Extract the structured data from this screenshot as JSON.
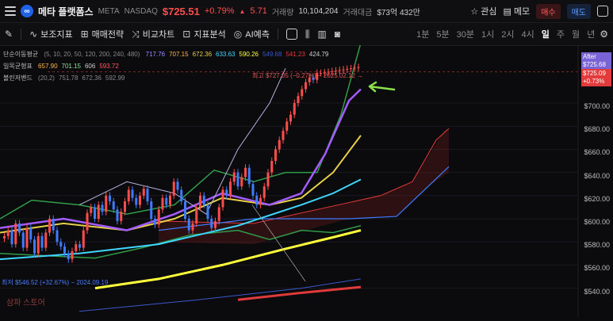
{
  "header": {
    "logo_letter": "∞",
    "name": "메타 플랫폼스",
    "ticker": "META",
    "exchange": "NASDAQ",
    "price": "$725.51",
    "change_pct": "+0.79%",
    "change_arrow": "▲",
    "change_abs": "5.71",
    "volume_label": "거래량",
    "volume_value": "10,104,204",
    "amount_label": "거래대금",
    "amount_value": "$73억 432만",
    "watch_label": "관심",
    "memo_label": "메모",
    "buy_label": "매수",
    "sell_label": "매도"
  },
  "toolbar": {
    "tools": [
      {
        "name": "ma-tool",
        "icon": "∿",
        "label": "보조지표"
      },
      {
        "name": "strategy-tool",
        "icon": "⊞",
        "label": "매매전략"
      },
      {
        "name": "compare-tool",
        "icon": "⤨",
        "label": "비교차트"
      },
      {
        "name": "analysis-tool",
        "icon": "⊡",
        "label": "지표분석"
      },
      {
        "name": "ai-tool",
        "icon": "◎",
        "label": "AI예측"
      }
    ],
    "timeframes": [
      "1분",
      "5분",
      "30분",
      "1시",
      "2시",
      "4시",
      "일",
      "주",
      "월",
      "년"
    ],
    "active_timeframe": "일"
  },
  "legend": {
    "sma_label": "단순이동평균",
    "sma_params": "(5, 10, 20, 50, 120, 200, 240, 480)",
    "sma_values": [
      {
        "v": "717.76",
        "c": "#9b8cff"
      },
      {
        "v": "707.15",
        "c": "#ffb84d"
      },
      {
        "v": "672.36",
        "c": "#e6d04a"
      },
      {
        "v": "633.63",
        "c": "#3fd6ff"
      },
      {
        "v": "590.26",
        "c": "#ffff3a"
      },
      {
        "v": "549.68",
        "c": "#3b58c9"
      },
      {
        "v": "541.23",
        "c": "#e23a3a"
      },
      {
        "v": "424.79",
        "c": "#cfcfcf"
      }
    ],
    "ichimoku_label": "일목균형표",
    "ichimoku_values": [
      {
        "v": "657.90",
        "c": "#ffb84d"
      },
      {
        "v": "701.15",
        "c": "#8ee08e"
      },
      {
        "v": "606",
        "c": "#cfcfcf"
      },
      {
        "v": "593.72",
        "c": "#ff5b5b"
      }
    ],
    "bb_label": "볼린저밴드",
    "bb_values": [
      {
        "v": "(20,2)",
        "c": "#888"
      },
      {
        "v": "751.78",
        "c": "#888"
      },
      {
        "v": "672.36",
        "c": "#888"
      },
      {
        "v": "592.99",
        "c": "#888"
      }
    ]
  },
  "price_axis": [
    "$700.00",
    "$680.00",
    "$660.00",
    "$640.00",
    "$620.00",
    "$600.00",
    "$580.00",
    "$560.00",
    "$540.00"
  ],
  "badges": {
    "after_label": "After",
    "after_price": "$725.68",
    "cur_price": "$725.09",
    "cur_pct": "+0.73%"
  },
  "annotations": {
    "high": "최고 $727.05 (−0.27%) − 2025.02.12 →",
    "low": "최저 $546.52 (+32.67%) − 2024.09.19",
    "watermark": "삼파 스토어"
  },
  "colors": {
    "up": "#ff4d4d",
    "down": "#3e7bff",
    "accent_buy": "#ff5b5b",
    "accent_sell": "#5b9dff"
  }
}
